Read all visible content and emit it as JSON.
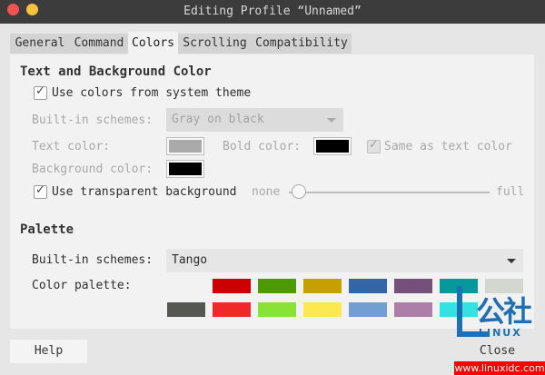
{
  "window": {
    "title": "Editing Profile “Unnamed”"
  },
  "tabs": [
    {
      "label": "General"
    },
    {
      "label": "Command"
    },
    {
      "label": "Colors"
    },
    {
      "label": "Scrolling"
    },
    {
      "label": "Compatibility"
    }
  ],
  "text_bg": {
    "heading": "Text and Background Color",
    "use_system_colors": {
      "label": "Use colors from system theme",
      "checked": true
    },
    "builtin_label": "Built-in schemes:",
    "builtin_value": "Gray on black",
    "text_color_label": "Text color:",
    "bold_color_label": "Bold color:",
    "same_as_text": {
      "label": "Same as text color",
      "checked": true
    },
    "background_label": "Background color:",
    "transparent": {
      "label": "Use transparent background",
      "checked": true
    },
    "slider_min": "none",
    "slider_max": "full",
    "transparency_level": 0.05,
    "text_color": "#aaaaaa",
    "bold_color": "#000000",
    "background_color": "#000000"
  },
  "palette": {
    "heading": "Palette",
    "builtin_label": "Built-in schemes:",
    "builtin_value": "Tango",
    "color_palette_label": "Color palette:",
    "colors": [
      "#f2f2f2",
      "#cc0000",
      "#4e9a06",
      "#c4a000",
      "#3465a4",
      "#75507b",
      "#06989a",
      "#d3d7cf",
      "#555753",
      "#ef2929",
      "#8ae234",
      "#fce94f",
      "#729fcf",
      "#ad7fa8",
      "#34e2e2",
      "#eeeeec"
    ]
  },
  "buttons": {
    "help": "Help",
    "close": "Close"
  },
  "watermark": {
    "brand": "公社",
    "sub": "LINUX",
    "url": "www.linuxidc.com"
  }
}
